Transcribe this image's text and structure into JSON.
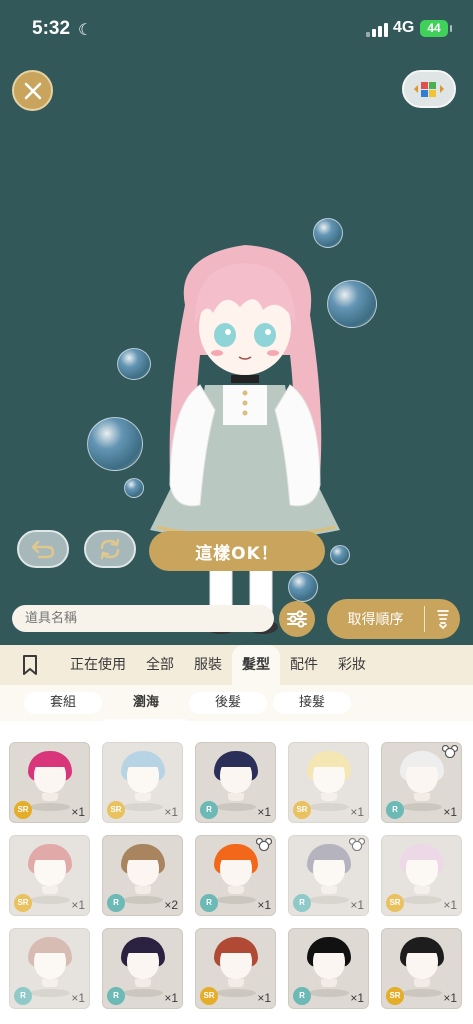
{
  "status_bar": {
    "time": "5:32",
    "network": "4G",
    "battery": "44"
  },
  "actions": {
    "confirm_label": "這樣OK！"
  },
  "search": {
    "placeholder": "道具名稱",
    "order_label": "取得順序"
  },
  "categories": [
    {
      "label": "正在使用"
    },
    {
      "label": "全部"
    },
    {
      "label": "服裝"
    },
    {
      "label": "髮型",
      "active": true
    },
    {
      "label": "配件"
    },
    {
      "label": "彩妝"
    }
  ],
  "sub_tabs": [
    {
      "label": "套組"
    },
    {
      "label": "瀏海",
      "active": true
    },
    {
      "label": "後髮"
    },
    {
      "label": "接髮"
    }
  ],
  "items": [
    {
      "hair": "#d9357a",
      "rarity": "SR",
      "qty": "×1",
      "faded": false,
      "bear": false
    },
    {
      "hair": "#9fc6dc",
      "rarity": "SR",
      "qty": "×1",
      "faded": true,
      "bear": false
    },
    {
      "hair": "#2b2e58",
      "rarity": "R",
      "qty": "×1",
      "faded": false,
      "bear": false
    },
    {
      "hair": "#f1df9a",
      "rarity": "SR",
      "qty": "×1",
      "faded": true,
      "bear": false
    },
    {
      "hair": "#eeeeee",
      "rarity": "R",
      "qty": "×1",
      "faded": false,
      "bear": true
    },
    {
      "hair": "#d98d8d",
      "rarity": "SR",
      "qty": "×1",
      "faded": true,
      "bear": false
    },
    {
      "hair": "#a8855e",
      "rarity": "R",
      "qty": "×2",
      "faded": false,
      "bear": false
    },
    {
      "hair": "#f2671a",
      "rarity": "R",
      "qty": "×1",
      "faded": false,
      "bear": true
    },
    {
      "hair": "#9b9aa9",
      "rarity": "R",
      "qty": "×1",
      "faded": true,
      "bear": true
    },
    {
      "hair": "#e6cbe0",
      "rarity": "SR",
      "qty": "×1",
      "faded": true,
      "bear": false
    },
    {
      "hair": "#c9a69a",
      "rarity": "R",
      "qty": "×1",
      "faded": true,
      "bear": false
    },
    {
      "hair": "#2a2240",
      "rarity": "R",
      "qty": "×1",
      "faded": false,
      "bear": false
    },
    {
      "hair": "#b04a35",
      "rarity": "SR",
      "qty": "×1",
      "faded": false,
      "bear": false
    },
    {
      "hair": "#111111",
      "rarity": "R",
      "qty": "×1",
      "faded": false,
      "bear": false
    },
    {
      "hair": "#1d1d1d",
      "rarity": "SR",
      "qty": "×1",
      "faded": false,
      "bear": false
    }
  ],
  "colors": {
    "accent": "#c9a45c",
    "background": "#33585a",
    "tab_bar": "#f4ecda"
  }
}
